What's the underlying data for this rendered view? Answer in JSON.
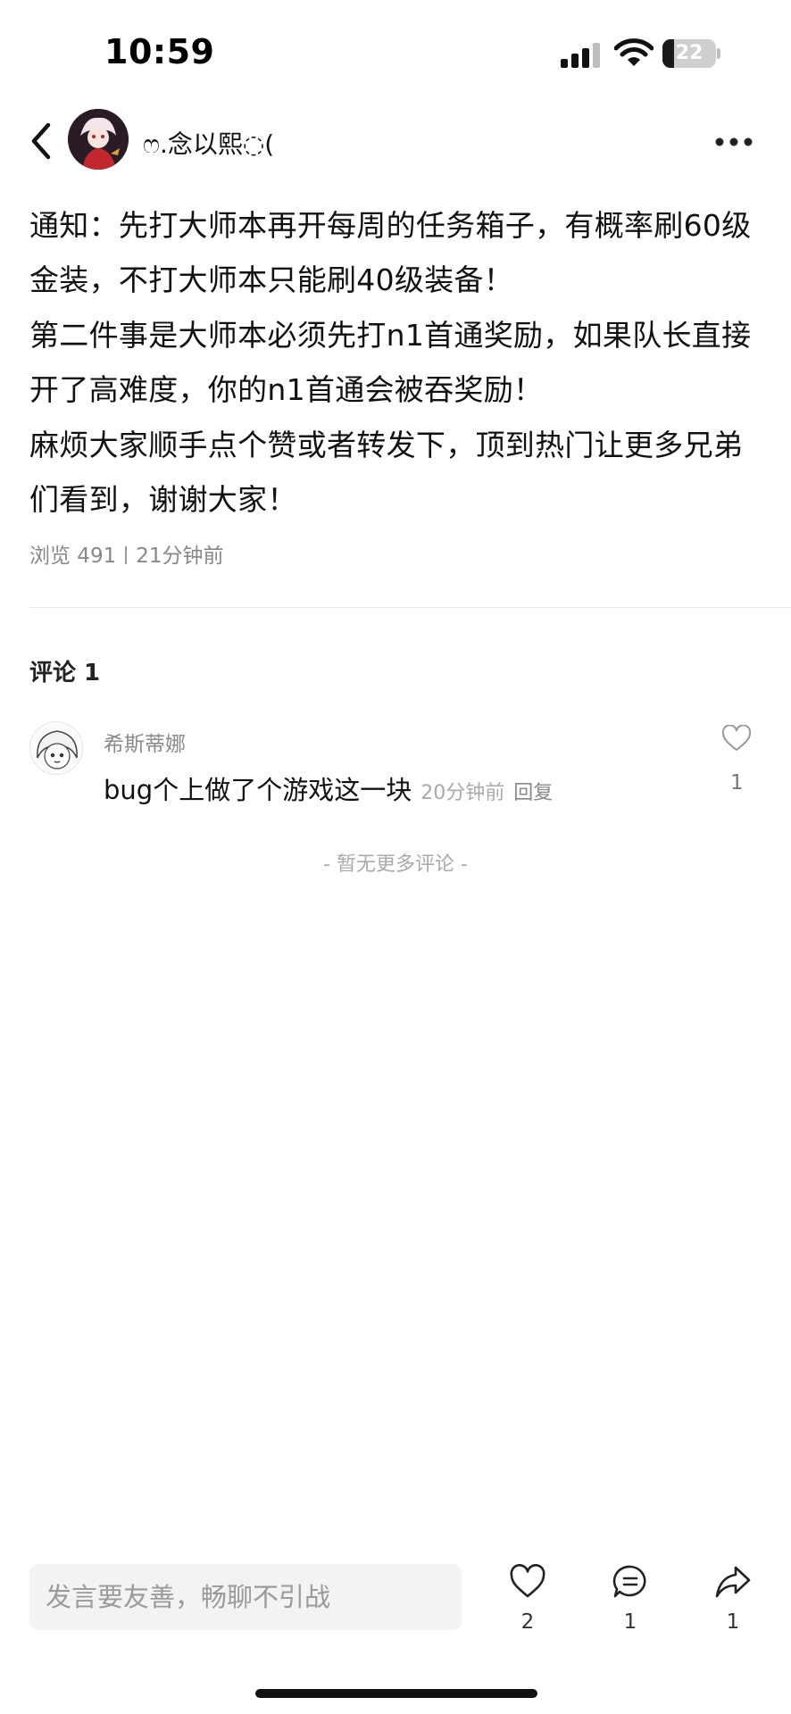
{
  "status_bar": {
    "time": "10:59",
    "battery": {
      "text": "22",
      "level_percent": 22
    },
    "icons": [
      "signal-icon",
      "wifi-icon",
      "battery-icon"
    ]
  },
  "header": {
    "back_icon": "chevron-left-icon",
    "username": "ෆ.念以熙◌(",
    "more_icon": "more-horizontal-icon"
  },
  "post": {
    "paragraphs": [
      "通知：先打大师本再开每周的任务箱子，有概率刷60级金装，不打大师本只能刷40级装备！",
      "第二件事是大师本必须先打n1首通奖励，如果队长直接开了高难度，你的n1首通会被吞奖励！",
      "麻烦大家顺手点个赞或者转发下，顶到热门让更多兄弟们看到，谢谢大家！"
    ],
    "views": "浏览 491",
    "time": "21分钟前"
  },
  "comments": {
    "title": "评论 1",
    "items": [
      {
        "name": "希斯蒂娜",
        "text": "bug个上做了个游戏这一块",
        "time": "20分钟前",
        "reply": "回复",
        "likes": "1"
      }
    ],
    "no_more": "- 暂无更多评论 -"
  },
  "bottom_bar": {
    "input_placeholder": "发言要友善，畅聊不引战",
    "like_count": "2",
    "comment_count": "1",
    "share_count": "1"
  },
  "colors": {
    "text": "#111111",
    "meta": "#888888",
    "input_bg": "#f3f3f3"
  }
}
